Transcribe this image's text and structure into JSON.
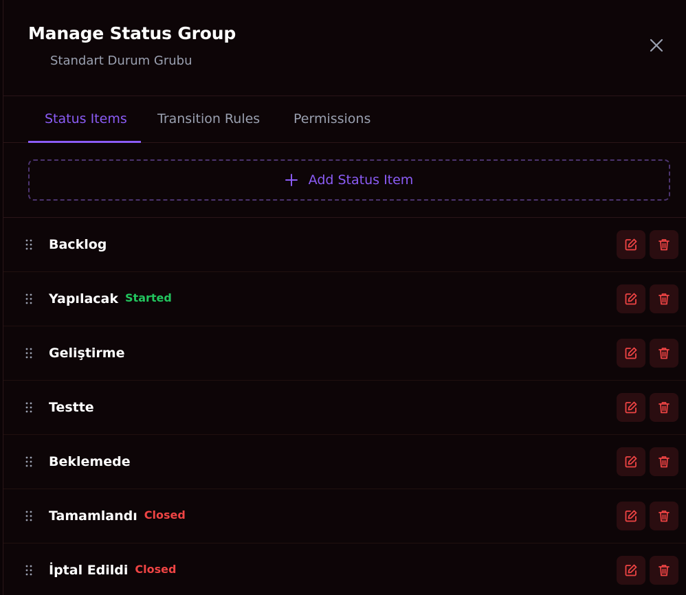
{
  "modal": {
    "title": "Manage Status Group",
    "subtitle": "Standart Durum Grubu"
  },
  "tabs": [
    {
      "label": "Status Items",
      "active": true
    },
    {
      "label": "Transition Rules",
      "active": false
    },
    {
      "label": "Permissions",
      "active": false
    }
  ],
  "add_button": {
    "label": "Add Status Item"
  },
  "items": [
    {
      "label": "Backlog",
      "badge": ""
    },
    {
      "label": "Yapılacak",
      "badge": "Started"
    },
    {
      "label": "Geliştirme",
      "badge": ""
    },
    {
      "label": "Testte",
      "badge": ""
    },
    {
      "label": "Beklemede",
      "badge": ""
    },
    {
      "label": "Tamamlandı",
      "badge": "Closed"
    },
    {
      "label": "İptal Edildi",
      "badge": "Closed"
    }
  ],
  "colors": {
    "accent": "#8b5cf6",
    "started": "#22c55e",
    "closed": "#ef4444",
    "danger_icon": "#ef4444"
  },
  "icons": {
    "close": "close-icon",
    "plus": "plus-icon",
    "drag": "drag-handle-icon",
    "edit": "edit-icon",
    "delete": "trash-icon"
  }
}
